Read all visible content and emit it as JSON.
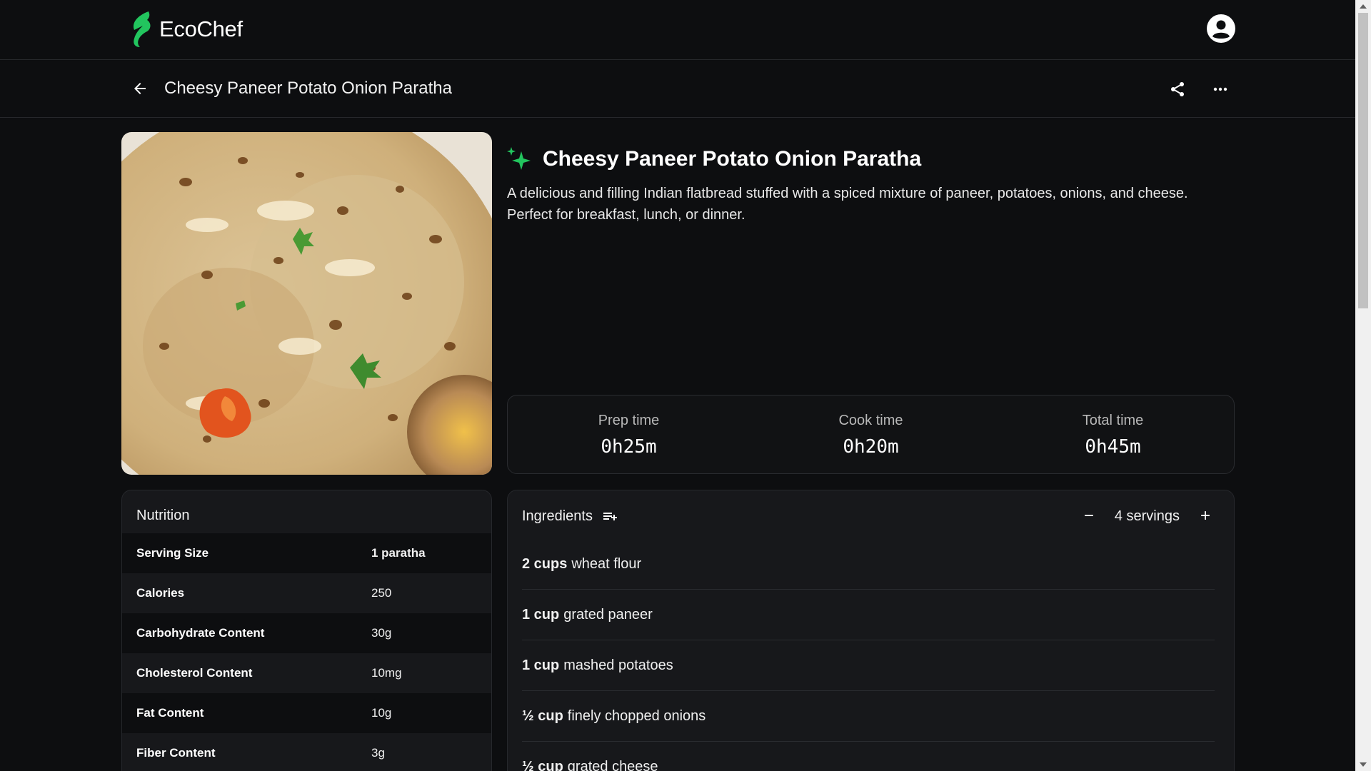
{
  "app": {
    "brand_name": "EcoChef",
    "accent_color": "#22c55e",
    "account_icon": "account-circle-icon"
  },
  "subheader": {
    "back_icon": "arrow-left-icon",
    "title": "Cheesy Paneer Potato Onion Paratha",
    "share_icon": "share-icon",
    "more_icon": "more-horizontal-icon"
  },
  "recipe": {
    "image_alt": "paratha-photo",
    "title": "Cheesy Paneer Potato Onion Paratha",
    "description": "A delicious and filling Indian flatbread stuffed with a spiced mixture of paneer, potatoes, onions, and cheese. Perfect for breakfast, lunch, or dinner.",
    "sparkle_icon": "sparkle-icon"
  },
  "times": [
    {
      "label": "Prep time",
      "value": "0h25m"
    },
    {
      "label": "Cook time",
      "value": "0h20m"
    },
    {
      "label": "Total time",
      "value": "0h45m"
    }
  ],
  "nutrition": {
    "title": "Nutrition",
    "rows": [
      {
        "name": "Serving Size",
        "value": "1 paratha"
      },
      {
        "name": "Calories",
        "value": "250"
      },
      {
        "name": "Carbohydrate Content",
        "value": "30g"
      },
      {
        "name": "Cholesterol Content",
        "value": "10mg"
      },
      {
        "name": "Fat Content",
        "value": "10g"
      },
      {
        "name": "Fiber Content",
        "value": "3g"
      }
    ]
  },
  "ingredients": {
    "title": "Ingredients",
    "add_to_list_icon": "playlist-add-icon",
    "servings_label": "4 servings",
    "decrease_label": "−",
    "increase_label": "+",
    "items": [
      {
        "qty": "2 cups",
        "name": "wheat flour"
      },
      {
        "qty": "1 cup",
        "name": "grated paneer"
      },
      {
        "qty": "1 cup",
        "name": "mashed potatoes"
      },
      {
        "qty": "½ cup",
        "name": "finely chopped onions"
      },
      {
        "qty": "½ cup",
        "name": "grated cheese"
      }
    ]
  }
}
